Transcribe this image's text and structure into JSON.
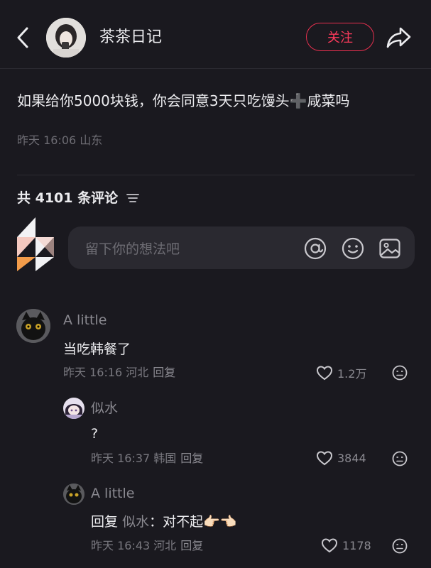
{
  "header": {
    "author_name": "茶茶日记",
    "follow_label": "关注"
  },
  "post": {
    "text": "如果给你5000块钱，你会同意3天只吃馒头➕咸菜吗",
    "meta": "昨天 16:06 山东"
  },
  "comments_header": {
    "label": "共 4101 条评论"
  },
  "input": {
    "placeholder": "留下你的想法吧"
  },
  "comments": [
    {
      "name": "A little",
      "text": "当吃韩餐了",
      "meta": "昨天 16:16 河北",
      "reply_label": "回复",
      "likes": "1.2万"
    },
    {
      "name": "似水",
      "text": "?",
      "meta": "昨天 16:37 韩国",
      "reply_label": "回复",
      "likes": "3844"
    },
    {
      "name": "A little",
      "reply_prefix": "回复",
      "reply_to": "似水",
      "reply_text": "：对不起👉🏻👈🏻",
      "meta": "昨天 16:43 河北",
      "reply_label": "回复",
      "likes": "1178"
    }
  ],
  "colors": {
    "background": "#1a191f",
    "accent": "#ff3b5c",
    "input_bg": "#2a2930",
    "muted_text": "#6d6c73"
  },
  "icons": {
    "back": "chevron-left-icon",
    "share": "share-arrow-icon",
    "filter": "filter-lines-icon",
    "at": "at-icon",
    "emoji": "smiley-icon",
    "image": "image-icon",
    "like": "heart-icon",
    "dislike": "dislike-face-icon"
  }
}
